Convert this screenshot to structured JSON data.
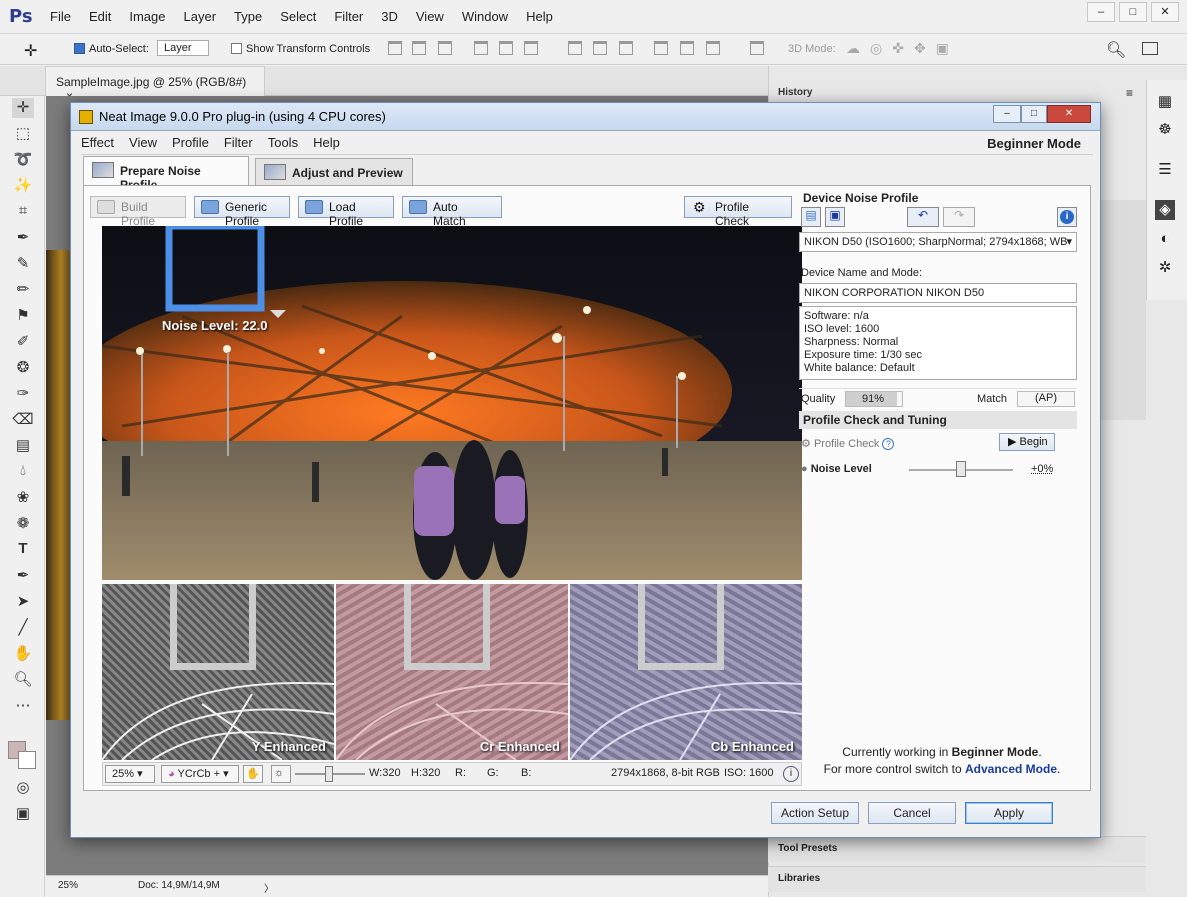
{
  "ps": {
    "logo": "Ps",
    "menu": [
      "File",
      "Edit",
      "Image",
      "Layer",
      "Type",
      "Select",
      "Filter",
      "3D",
      "View",
      "Window",
      "Help"
    ],
    "options": {
      "auto_select_label": "Auto-Select:",
      "auto_select_value": "Layer",
      "show_transform": "Show Transform Controls",
      "mode_3d": "3D Mode:"
    },
    "doc_tab": "SampleImage.jpg @ 25% (RGB/8#)",
    "doc_tab_close": "×",
    "status_zoom": "25%",
    "status_doc": "Doc: 14,9M/14,9M",
    "status_arrow": "〉",
    "panels": {
      "history": "History",
      "tool_presets": "Tool Presets",
      "libraries": "Libraries"
    }
  },
  "dialog": {
    "title": "Neat Image 9.0.0 Pro plug-in (using 4 CPU cores)",
    "menu": [
      "Effect",
      "View",
      "Profile",
      "Filter",
      "Tools",
      "Help"
    ],
    "mode": "Beginner Mode",
    "tabs": {
      "prepare": "Prepare Noise Profile",
      "adjust": "Adjust and Preview"
    },
    "buttons": {
      "build_profile": "Build Profile",
      "generic_profile": "Generic Profile",
      "load_profile": "Load Profile",
      "auto_match": "Auto Match",
      "profile_check": "Profile Check"
    },
    "preview": {
      "noise_level_label": "Noise Level: 22.0",
      "thumbs": [
        "Y Enhanced",
        "Cr Enhanced",
        "Cb Enhanced"
      ]
    },
    "bottom_bar": {
      "zoom": "25%",
      "color_mode": "YCrCb +",
      "w": "W:320",
      "h": "H:320",
      "r": "R:",
      "g": "G:",
      "b": "B:",
      "info": "2794x1868, 8-bit RGB",
      "iso": "ISO: 1600"
    },
    "device": {
      "heading": "Device Noise Profile",
      "profile_select": "NIKON D50 (ISO1600; SharpNormal; 2794x1868; WB",
      "name_label": "Device Name and Mode:",
      "name_value": "NIKON CORPORATION NIKON D50",
      "details": [
        "Software: n/a",
        "ISO level: 1600",
        "Sharpness: Normal",
        "Exposure time: 1/30 sec",
        "White balance: Default"
      ],
      "quality_label": "Quality",
      "quality_value": "91%",
      "match_label": "Match",
      "match_value": "(AP)",
      "tuning_heading": "Profile Check and Tuning",
      "profile_check_label": "Profile Check",
      "begin": "Begin",
      "noise_level_label": "Noise Level",
      "noise_level_value": "+0%",
      "noise_level_slider": 0.5,
      "working_line1_pre": "Currently working in ",
      "working_line1_mode": "Beginner Mode",
      "working_line1_post": ".",
      "working_line2_pre": "For more control switch to ",
      "working_line2_link": "Advanced Mode",
      "working_line2_post": "."
    },
    "footer": {
      "action_setup": "Action Setup",
      "cancel": "Cancel",
      "apply": "Apply"
    }
  },
  "colors": {
    "accent": "#3b73c7",
    "link": "#1a3aa0",
    "quality_fill": "#cfcfcf"
  }
}
